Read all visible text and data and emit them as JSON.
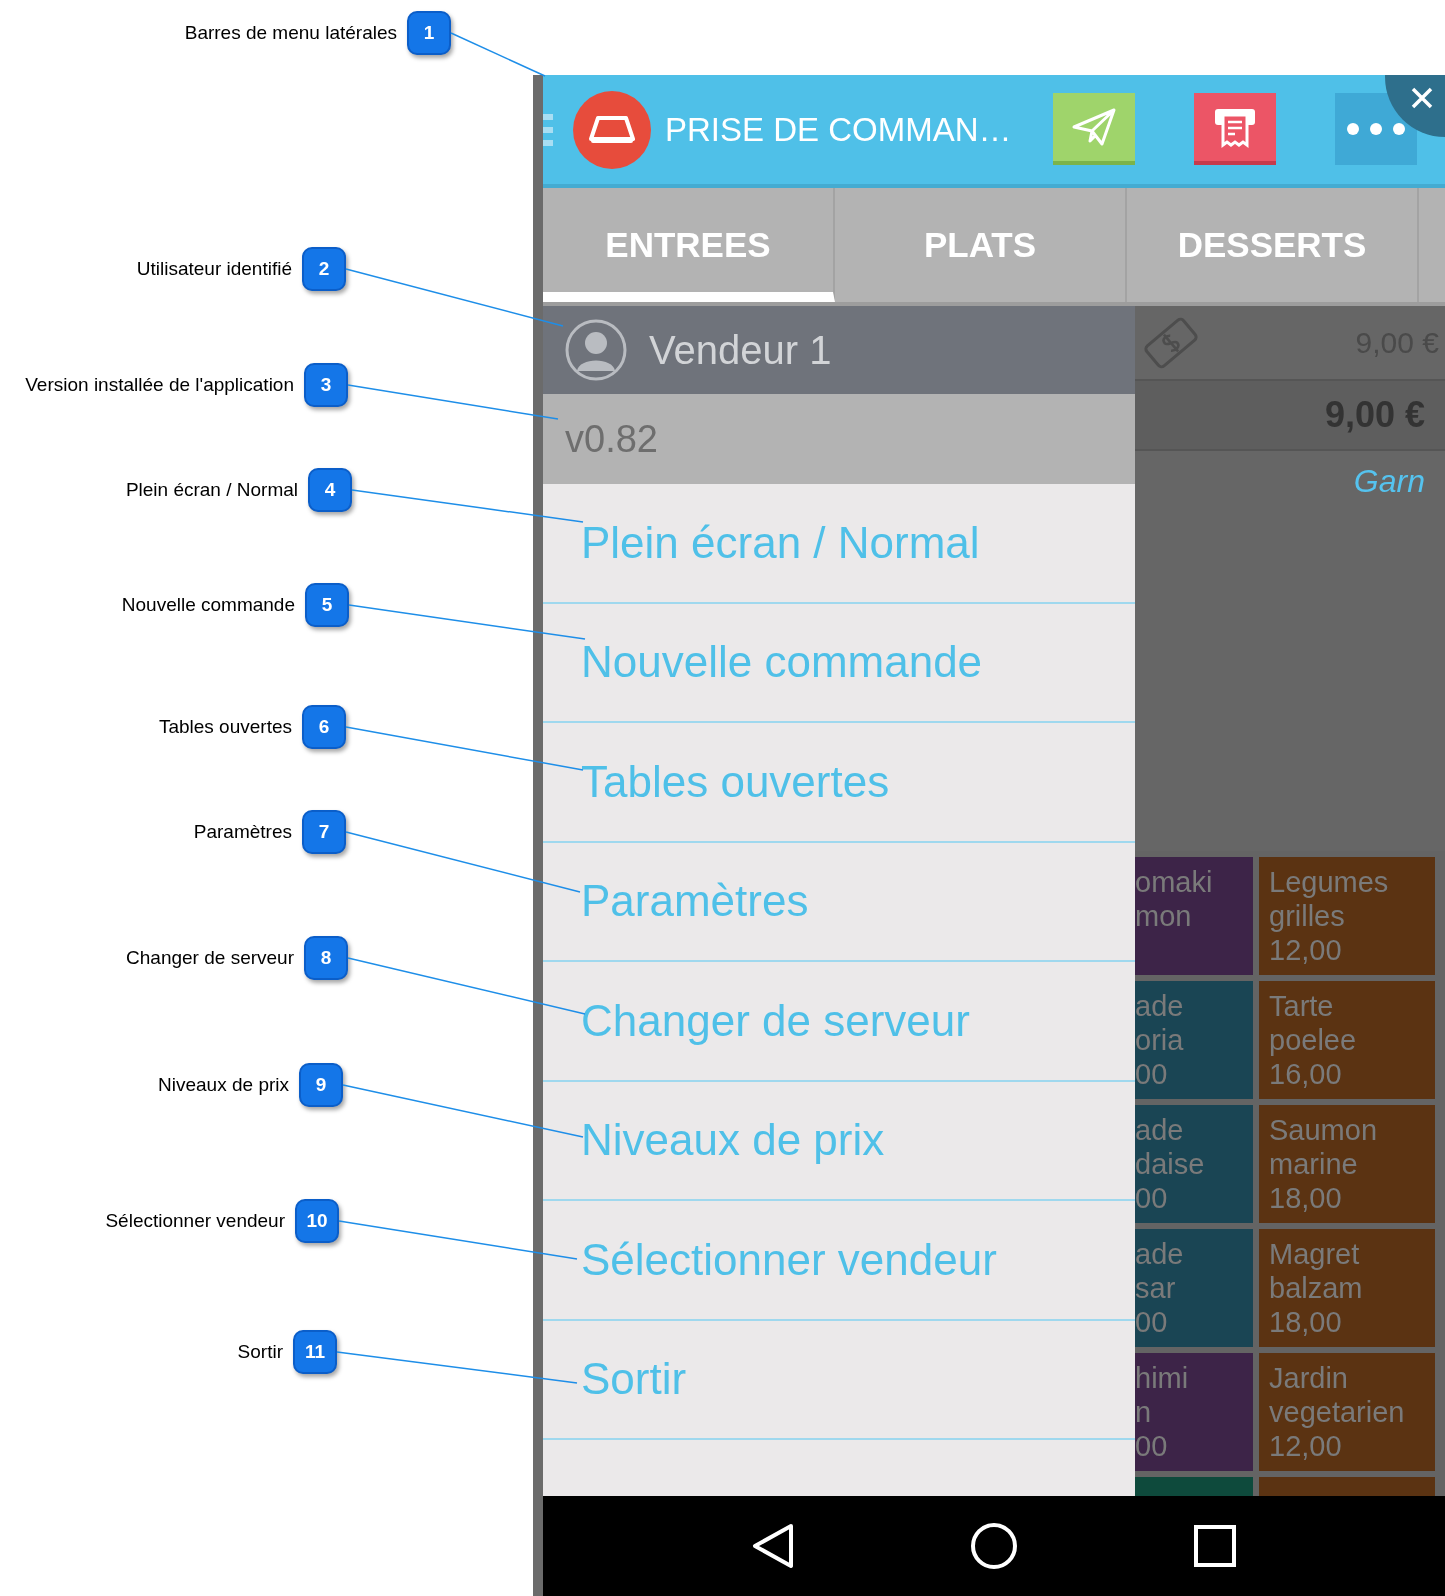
{
  "callouts": [
    {
      "number": "1",
      "label": "Barres de menu latérales"
    },
    {
      "number": "2",
      "label": "Utilisateur identifié"
    },
    {
      "number": "3",
      "label": "Version installée de l'application"
    },
    {
      "number": "4",
      "label": "Plein écran / Normal"
    },
    {
      "number": "5",
      "label": "Nouvelle commande"
    },
    {
      "number": "6",
      "label": "Tables ouvertes"
    },
    {
      "number": "7",
      "label": "Paramètres"
    },
    {
      "number": "8",
      "label": "Changer de serveur"
    },
    {
      "number": "9",
      "label": "Niveaux de prix"
    },
    {
      "number": "10",
      "label": "Sélectionner vendeur"
    },
    {
      "number": "11",
      "label": "Sortir"
    }
  ],
  "app": {
    "header": {
      "title": "PRISE DE COMMAN…"
    },
    "tabs": [
      {
        "label": "ENTREES",
        "selected": true
      },
      {
        "label": "PLATS",
        "selected": false
      },
      {
        "label": "DESSERTS",
        "selected": false
      }
    ],
    "drawer": {
      "user": "Vendeur 1",
      "version": "v0.82",
      "items": [
        "Plein écran / Normal",
        "Nouvelle commande",
        "Tables ouvertes",
        "Paramètres",
        "Changer de serveur",
        "Niveaux de prix",
        "Sélectionner vendeur",
        "Sortir"
      ]
    },
    "background": {
      "price": "9,00 €",
      "total": "9,00 €",
      "column_label": "Garn",
      "tiles": [
        {
          "lines": [
            "omaki",
            "mon"
          ],
          "color": "#3d2448"
        },
        {
          "lines": [
            "Legumes",
            "grilles",
            "12,00"
          ],
          "color": "#5b3312"
        },
        {
          "lines": [
            "ade",
            "oria",
            "00"
          ],
          "color": "#1a4554"
        },
        {
          "lines": [
            "Tarte",
            "poelee",
            "16,00"
          ],
          "color": "#5b3312"
        },
        {
          "lines": [
            "ade",
            "daise",
            "00"
          ],
          "color": "#1a4554"
        },
        {
          "lines": [
            "Saumon",
            "marine",
            "18,00"
          ],
          "color": "#5b3312"
        },
        {
          "lines": [
            "ade",
            "sar",
            "00"
          ],
          "color": "#1a4554"
        },
        {
          "lines": [
            "Magret",
            "balzam",
            "18,00"
          ],
          "color": "#5b3312"
        },
        {
          "lines": [
            "himi",
            "n",
            "00"
          ],
          "color": "#3d2448"
        },
        {
          "lines": [
            "Jardin",
            "vegetarien",
            "12,00"
          ],
          "color": "#5b3312"
        },
        {
          "color": "#0e4a3c"
        },
        {
          "color": "#5b3312"
        }
      ]
    }
  }
}
